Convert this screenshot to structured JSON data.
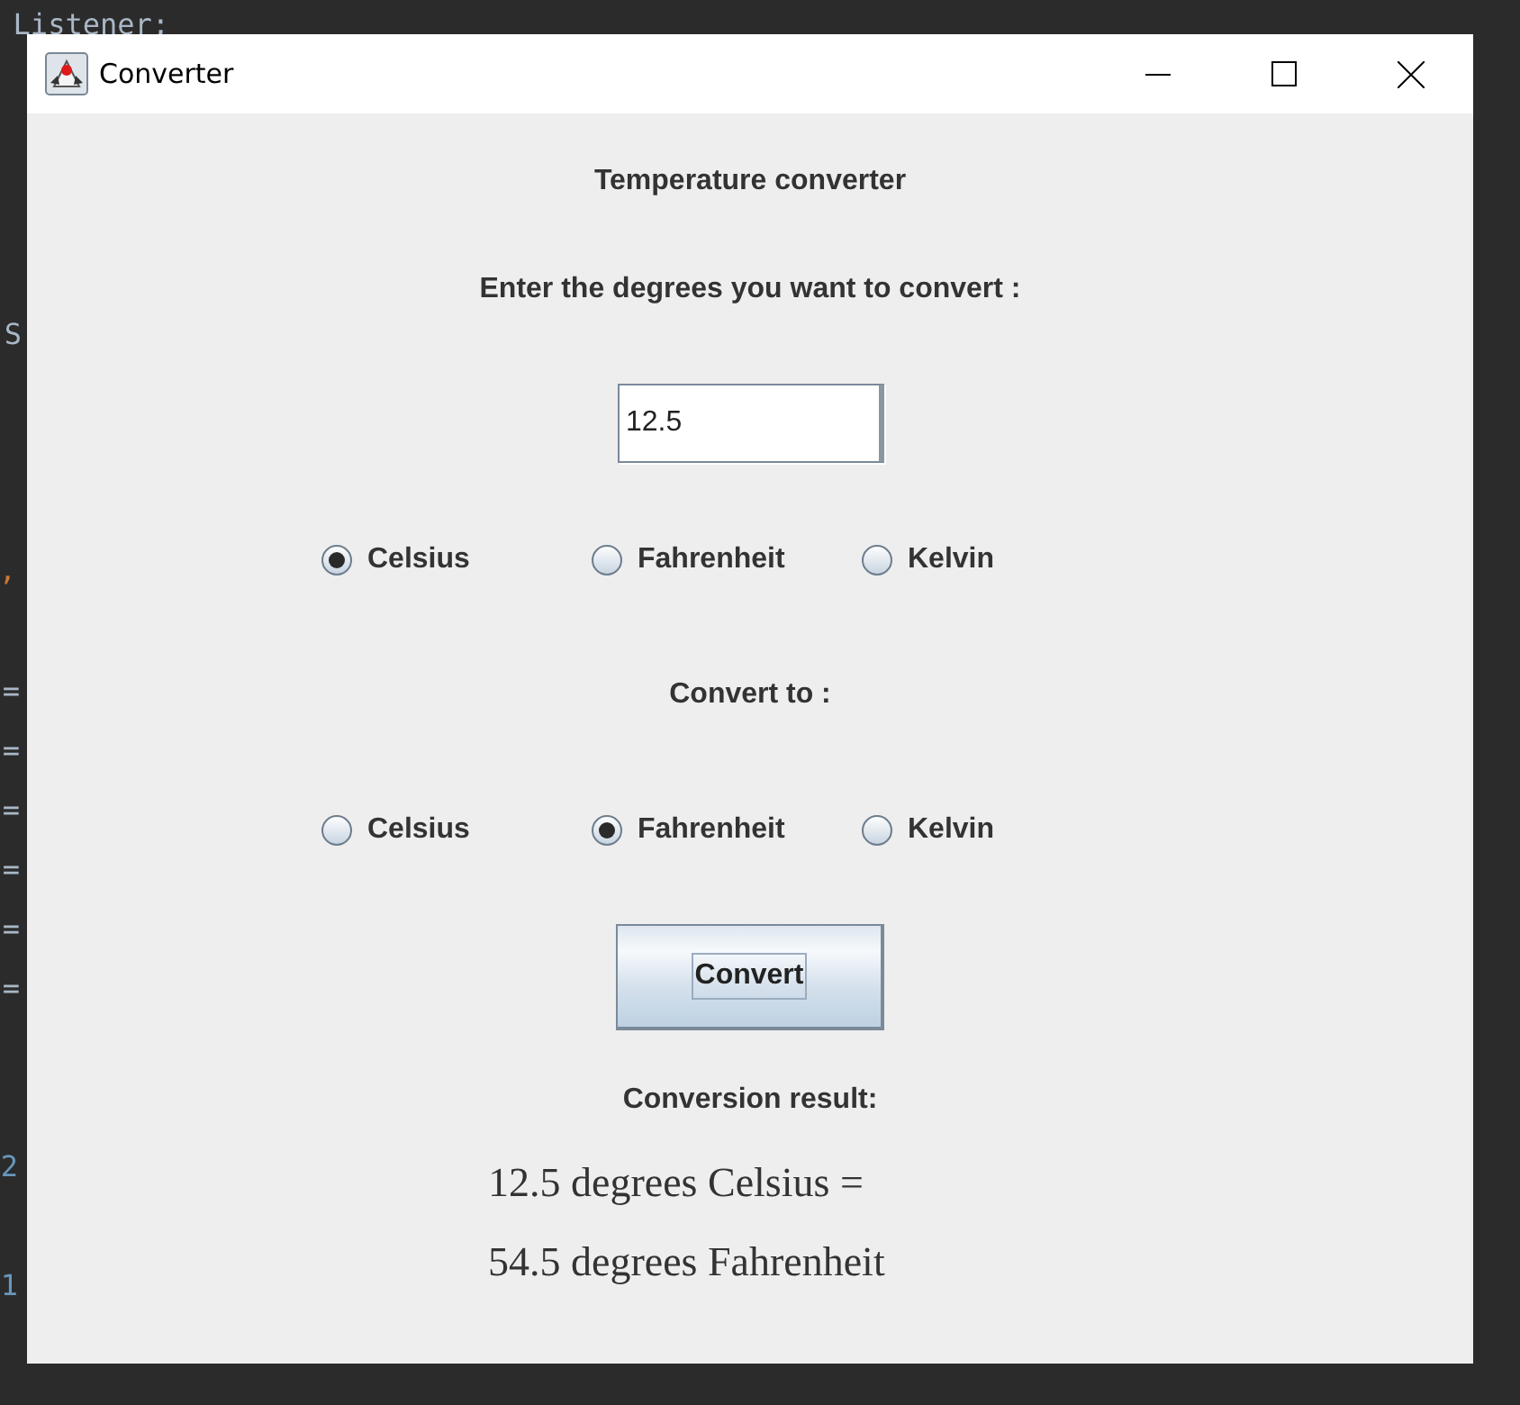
{
  "background": {
    "code_fragments": [
      {
        "text": "Listener;",
        "color": "#a9b7c6"
      },
      {
        "text": "S",
        "color": "#a9b7c6"
      },
      {
        "text": ",",
        "color": "#cc7832"
      },
      {
        "text": "=",
        "color": "#a9b7c6"
      },
      {
        "text": "=",
        "color": "#a9b7c6"
      },
      {
        "text": "=",
        "color": "#a9b7c6"
      },
      {
        "text": "=",
        "color": "#a9b7c6"
      },
      {
        "text": "=",
        "color": "#a9b7c6"
      },
      {
        "text": "=",
        "color": "#a9b7c6"
      },
      {
        "text": "2",
        "color": "#6897bb"
      },
      {
        "text": "1",
        "color": "#6897bb"
      }
    ]
  },
  "window": {
    "title": "Converter"
  },
  "heading": "Temperature converter",
  "prompt": "Enter the degrees you want to convert :",
  "degrees_field": {
    "value": "12.5"
  },
  "from_units": [
    {
      "label": "Celsius",
      "selected": true
    },
    {
      "label": "Fahrenheit",
      "selected": false
    },
    {
      "label": "Kelvin",
      "selected": false
    }
  ],
  "convert_to_label": "Convert to :",
  "to_units": [
    {
      "label": "Celsius",
      "selected": false
    },
    {
      "label": "Fahrenheit",
      "selected": true
    },
    {
      "label": "Kelvin",
      "selected": false
    }
  ],
  "convert_button": {
    "label": "Convert"
  },
  "result_label": "Conversion result:",
  "result_lines": [
    "12.5 degrees Celsius =",
    "54.5 degrees Fahrenheit"
  ]
}
